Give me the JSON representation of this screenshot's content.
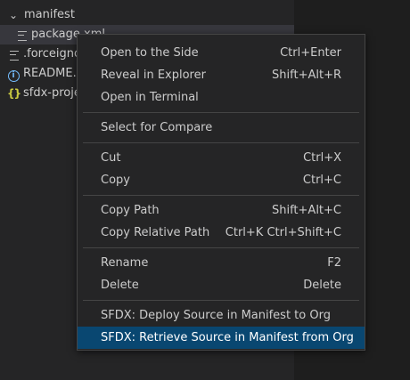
{
  "explorer": {
    "items": [
      {
        "label": "manifest",
        "icon": "chevron-down-icon"
      },
      {
        "label": "package.xml",
        "icon": "lines-icon"
      },
      {
        "label": ".forceignore",
        "icon": "lines-icon"
      },
      {
        "label": "README.md",
        "icon": "info-icon"
      },
      {
        "label": "sfdx-project.json",
        "icon": "json-braces-icon"
      }
    ]
  },
  "context_menu": {
    "groups": [
      [
        {
          "label": "Open to the Side",
          "shortcut": "Ctrl+Enter"
        },
        {
          "label": "Reveal in Explorer",
          "shortcut": "Shift+Alt+R"
        },
        {
          "label": "Open in Terminal",
          "shortcut": ""
        }
      ],
      [
        {
          "label": "Select for Compare",
          "shortcut": ""
        }
      ],
      [
        {
          "label": "Cut",
          "shortcut": "Ctrl+X"
        },
        {
          "label": "Copy",
          "shortcut": "Ctrl+C"
        }
      ],
      [
        {
          "label": "Copy Path",
          "shortcut": "Shift+Alt+C"
        },
        {
          "label": "Copy Relative Path",
          "shortcut": "Ctrl+K Ctrl+Shift+C"
        }
      ],
      [
        {
          "label": "Rename",
          "shortcut": "F2"
        },
        {
          "label": "Delete",
          "shortcut": "Delete"
        }
      ],
      [
        {
          "label": "SFDX: Deploy Source in Manifest to Org",
          "shortcut": ""
        },
        {
          "label": "SFDX: Retrieve Source in Manifest from Org",
          "shortcut": ""
        }
      ]
    ]
  },
  "colors": {
    "sidebar_bg": "#252526",
    "editor_bg": "#1e1e1e",
    "menu_highlight": "#094771",
    "separator": "#454545"
  }
}
